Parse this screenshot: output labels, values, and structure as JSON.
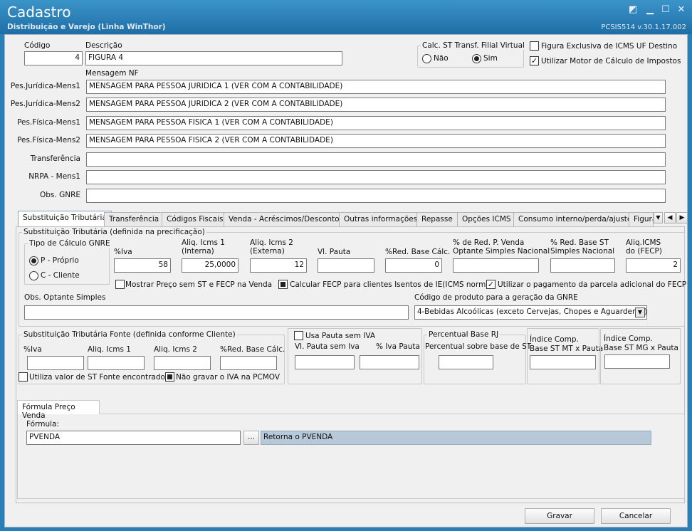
{
  "window": {
    "title": "Cadastro",
    "subtitle": "Distribuição e Varejo (Linha WinThor)",
    "version": "PCSIS514  v.30.1.17.002"
  },
  "header": {
    "codigo_label": "Código",
    "codigo_value": "4",
    "descricao_label": "Descrição",
    "descricao_value": "FIGURA 4",
    "calc_st_title": "Calc. ST Transf. Filial Virtual",
    "calc_st_nao": "Não",
    "calc_st_sim": "Sim",
    "figura_exclusiva": "Figura Exclusiva de ICMS UF Destino",
    "utilizar_motor": "Utilizar Motor de Cálculo de Impostos",
    "mensagem_nf_label": "Mensagem NF"
  },
  "messages": [
    {
      "label": "Pes.Jurídica-Mens1",
      "value": "MENSAGEM PARA PESSOA JURIDICA 1 (VER COM A CONTABILIDADE)"
    },
    {
      "label": "Pes.Jurídica-Mens2",
      "value": "MENSAGEM PARA PESSOA JURIDICA 2 (VER COM A CONTABILIDADE)"
    },
    {
      "label": "Pes.Física-Mens1",
      "value": "MENSAGEM PARA PESSOA FISICA 1 (VER COM A CONTABILIDADE)"
    },
    {
      "label": "Pes.Física-Mens2",
      "value": "MENSAGEM PARA PESSOA FISICA 2 (VER COM A CONTABILIDADE)"
    },
    {
      "label": "Transferência",
      "value": ""
    },
    {
      "label": "NRPA - Mens1",
      "value": ""
    },
    {
      "label": "Obs. GNRE",
      "value": ""
    }
  ],
  "tabs": [
    "Substituição Tributária",
    "Transferência",
    "Códigos Fiscais",
    "Venda - Acréscimos/Descontos",
    "Outras informações",
    "Repasse",
    "Opções ICMS",
    "Consumo interno/perda/ajuste",
    "Figura"
  ],
  "st": {
    "group_title": "Substituição Tributária (definida na precificação)",
    "tipo_gnre_title": "Tipo de Cálculo GNRE",
    "tipo_p": "P - Próprio",
    "tipo_c": "C - Cliente",
    "iva_label": "%Iva",
    "iva_value": "58",
    "aliq1_label1": "Aliq. Icms 1",
    "aliq1_label2": "(Interna)",
    "aliq1_value": "25,0000",
    "aliq2_label1": "Aliq. Icms 2",
    "aliq2_label2": "(Externa)",
    "aliq2_value": "12",
    "vlpauta_label": "Vl. Pauta",
    "vlpauta_value": "",
    "redbase_label": "%Red. Base Cálc.",
    "redbase_value": "0",
    "redpvenda_label1": "% de Red. P. Venda",
    "redpvenda_label2": "Optante Simples Nacional",
    "redpvenda_value": "",
    "redbasest_label1": "% Red. Base ST",
    "redbasest_label2": "Simples Nacional",
    "redbasest_value": "",
    "aliqfecp_label1": "Aliq.ICMS",
    "aliqfecp_label2": "do (FECP)",
    "aliqfecp_value": "2",
    "mostrar_preco": "Mostrar Preço sem ST e FECP na Venda",
    "calcular_fecp": "Calcular FECP para clientes Isentos de IE(ICMS normal)",
    "utilizar_pagamento": "Utilizar o pagamento da parcela adicional do FECP",
    "obs_optante_label": "Obs. Optante Simples",
    "obs_optante_value": "",
    "codigo_produto_label": "Código de produto para a geração da GNRE",
    "codigo_produto_value": "4-Bebidas Alcoólicas (exceto Cervejas, Chopes e Aguardente)"
  },
  "st_fonte": {
    "group_title": "Substituição Tributária Fonte (definida conforme Cliente)",
    "iva_label": "%Iva",
    "aliq1_label": "Aliq. Icms 1",
    "aliq2_label": "Aliq. Icms 2",
    "redbase_label": "%Red. Base Cálc.",
    "utiliza_valor": "Utiliza valor de ST Fonte encontrado",
    "nao_gravar": "Não gravar o IVA na PCMOV"
  },
  "pauta": {
    "usa_pauta": "Usa Pauta sem IVA",
    "vl_pauta_label": "Vl. Pauta sem Iva",
    "iva_pauta_label": "% Iva Pauta"
  },
  "rj": {
    "title": "Percentual Base RJ",
    "label": "Percentual sobre base de ST"
  },
  "mt": {
    "label1": "Índice Comp.",
    "label2": "Base ST MT x Pauta"
  },
  "mg": {
    "label1": "Índice Comp.",
    "label2": "Base ST MG x Pauta"
  },
  "formula": {
    "tab": "Fórmula Preço Venda",
    "label": "Fórmula:",
    "value": "PVENDA",
    "button": "...",
    "description": "Retorna o PVENDA"
  },
  "footer": {
    "gravar": "Gravar",
    "cancelar": "Cancelar"
  }
}
